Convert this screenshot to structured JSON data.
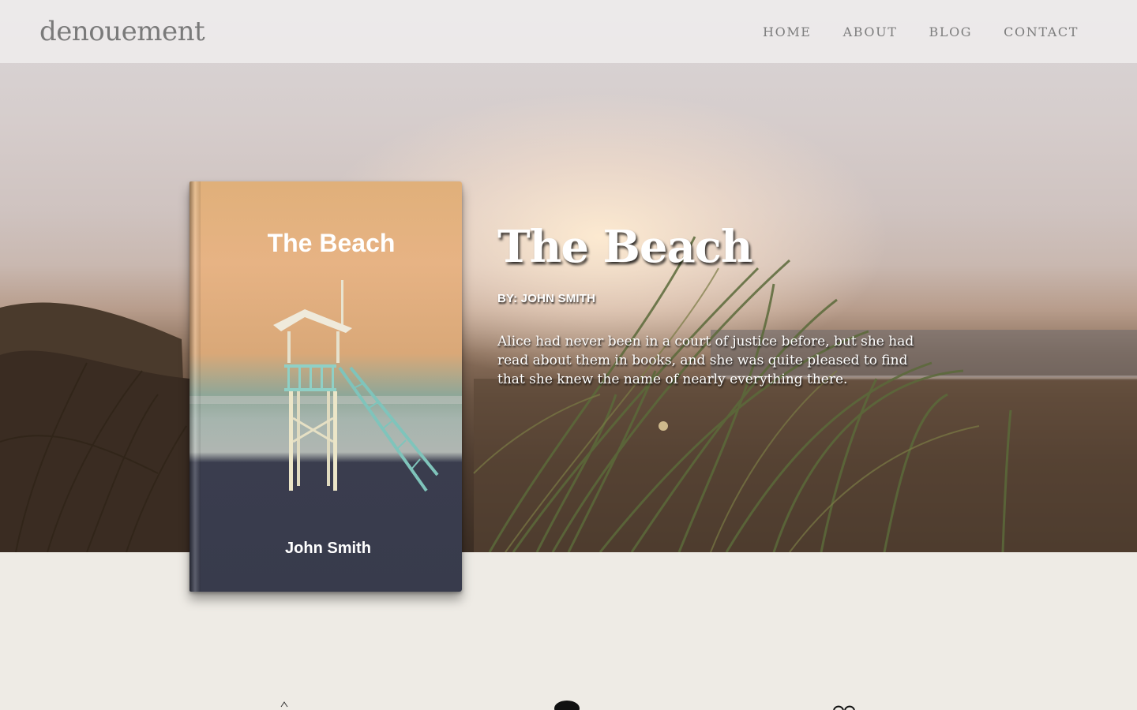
{
  "header": {
    "logo": "denouement",
    "nav": [
      {
        "label": "HOME"
      },
      {
        "label": "ABOUT"
      },
      {
        "label": "BLOG"
      },
      {
        "label": "CONTACT"
      }
    ]
  },
  "book": {
    "cover_title": "The Beach",
    "cover_author": "John Smith"
  },
  "hero": {
    "title": "The Beach",
    "byline": "BY: JOHN SMITH",
    "description": "Alice had never been in a court of justice before, but she had read about them in books, and she was quite pleased to find that she knew the name of nearly everything there."
  },
  "colors": {
    "page_background": "#eeebe5",
    "header_text": "#7a7a7a"
  }
}
